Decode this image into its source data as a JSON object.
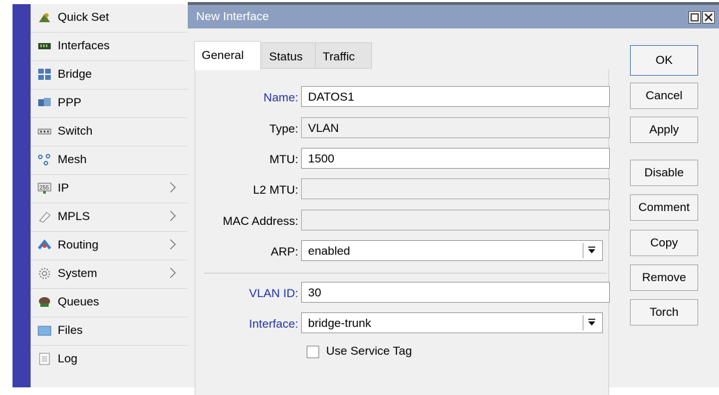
{
  "menu": {
    "items": [
      {
        "label": "Quick Set",
        "icon": "quick-set-icon",
        "submenu": false
      },
      {
        "label": "Interfaces",
        "icon": "interfaces-icon",
        "submenu": false
      },
      {
        "label": "Bridge",
        "icon": "bridge-icon",
        "submenu": false
      },
      {
        "label": "PPP",
        "icon": "ppp-icon",
        "submenu": false
      },
      {
        "label": "Switch",
        "icon": "switch-icon",
        "submenu": false
      },
      {
        "label": "Mesh",
        "icon": "mesh-icon",
        "submenu": false
      },
      {
        "label": "IP",
        "icon": "ip-icon",
        "submenu": true
      },
      {
        "label": "MPLS",
        "icon": "mpls-icon",
        "submenu": true
      },
      {
        "label": "Routing",
        "icon": "routing-icon",
        "submenu": true
      },
      {
        "label": "System",
        "icon": "system-icon",
        "submenu": true
      },
      {
        "label": "Queues",
        "icon": "queues-icon",
        "submenu": false
      },
      {
        "label": "Files",
        "icon": "files-icon",
        "submenu": false
      },
      {
        "label": "Log",
        "icon": "log-icon",
        "submenu": false
      }
    ]
  },
  "window": {
    "title": "New Interface",
    "tabs": [
      {
        "label": "General",
        "active": true
      },
      {
        "label": "Status",
        "active": false
      },
      {
        "label": "Traffic",
        "active": false
      }
    ]
  },
  "form": {
    "name_label": "Name:",
    "name_value": "DATOS1",
    "type_label": "Type:",
    "type_value": "VLAN",
    "mtu_label": "MTU:",
    "mtu_value": "1500",
    "l2mtu_label": "L2 MTU:",
    "l2mtu_value": "",
    "mac_label": "MAC Address:",
    "mac_value": "",
    "arp_label": "ARP:",
    "arp_value": "enabled",
    "vlanid_label": "VLAN ID:",
    "vlanid_value": "30",
    "interface_label": "Interface:",
    "interface_value": "bridge-trunk",
    "service_tag_label": "Use Service Tag",
    "service_tag_checked": false
  },
  "buttons": {
    "ok": "OK",
    "cancel": "Cancel",
    "apply": "Apply",
    "disable": "Disable",
    "comment": "Comment",
    "copy": "Copy",
    "remove": "Remove",
    "torch": "Torch"
  },
  "colors": {
    "sidebar_bar": "#3d3fae",
    "titlebar": "#8c9fc0",
    "label_highlight": "#2433a8"
  }
}
